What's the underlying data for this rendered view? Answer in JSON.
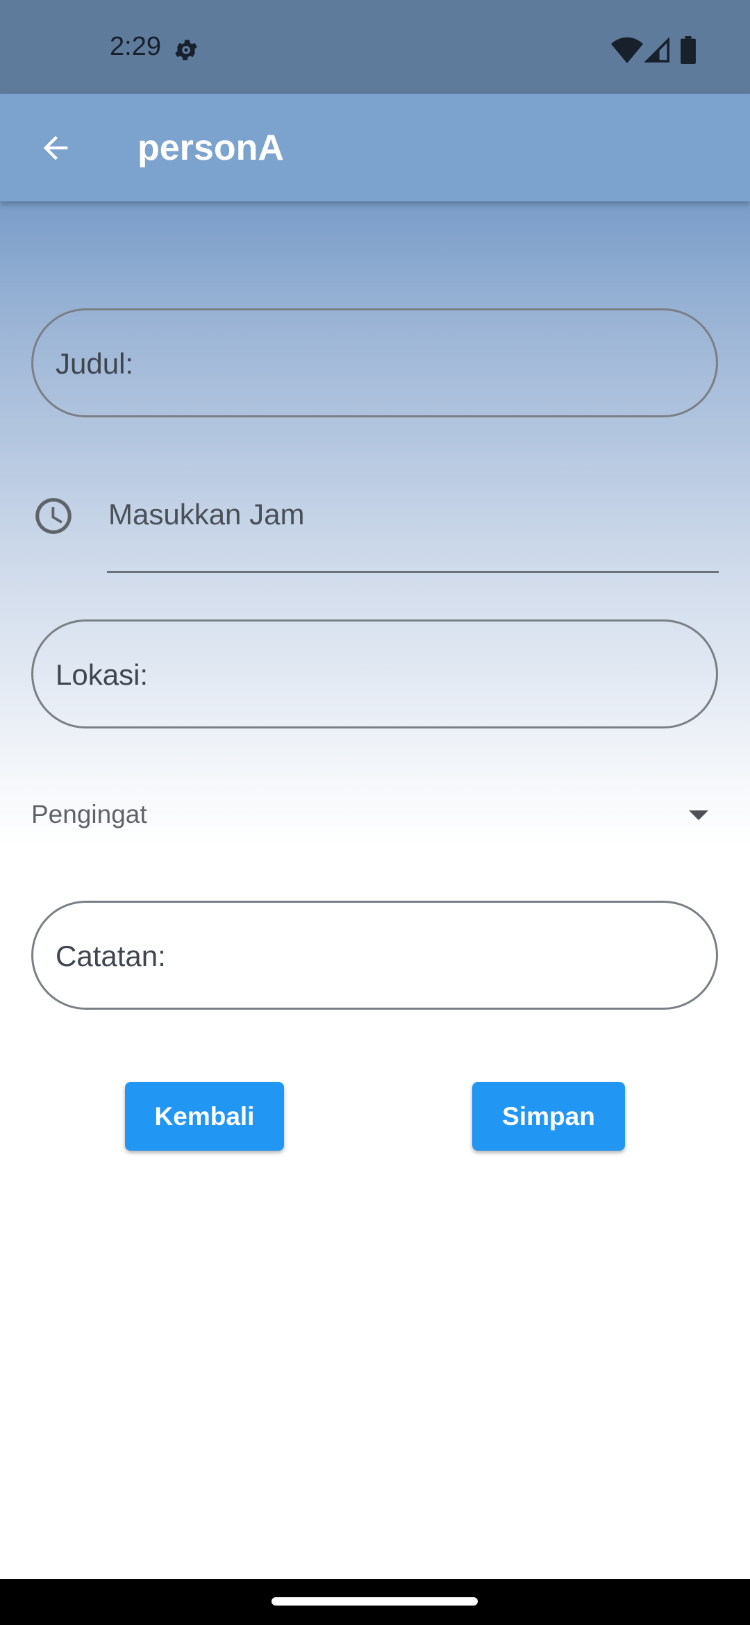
{
  "status_bar": {
    "time": "2:29"
  },
  "app_bar": {
    "title": "personA"
  },
  "form": {
    "judul_placeholder": "Judul:",
    "time_placeholder": "Masukkan Jam",
    "lokasi_placeholder": "Lokasi:",
    "reminder_label": "Pengingat",
    "catatan_placeholder": "Catatan:"
  },
  "buttons": {
    "back_label": "Kembali",
    "save_label": "Simpan"
  },
  "colors": {
    "status_bar": "#5f7b9c",
    "app_bar": "#7ca2ce",
    "button": "#2196f3"
  },
  "icons": {
    "status": [
      "gear-icon",
      "wifi-icon",
      "signal-icon",
      "battery-icon"
    ],
    "app_bar": "arrow-back-icon",
    "time_field": "clock-icon",
    "dropdown": "dropdown-arrow-icon"
  }
}
